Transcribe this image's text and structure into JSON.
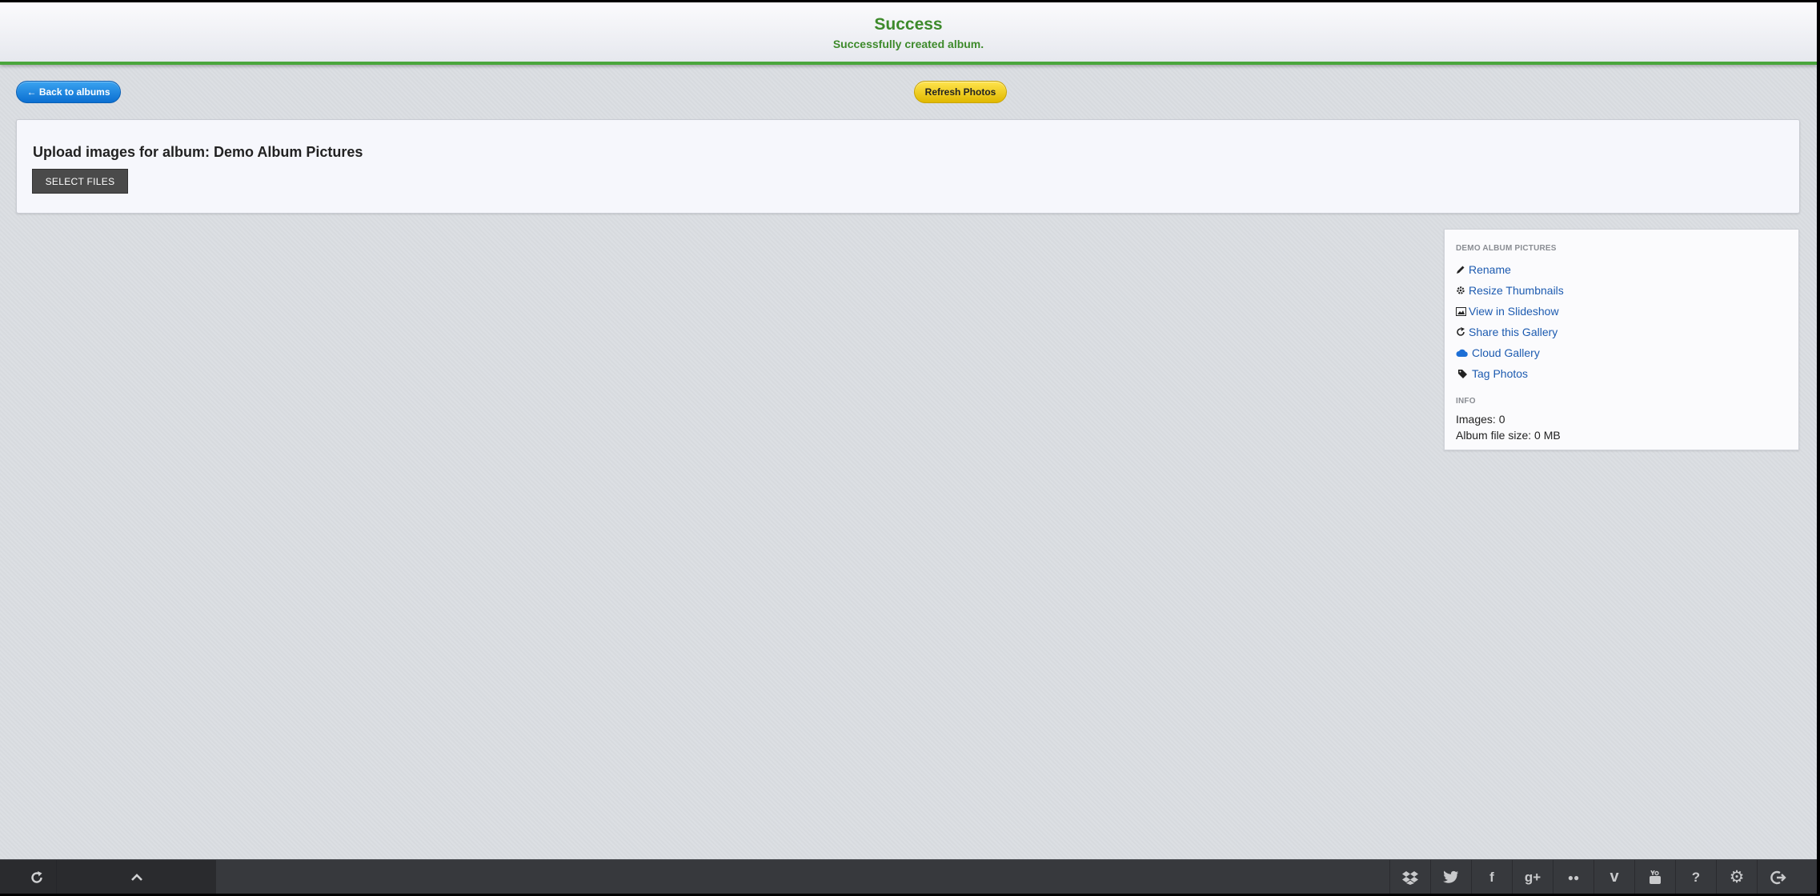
{
  "banner": {
    "title": "Success",
    "message": "Successfully created album.",
    "color": "#3d8a2b"
  },
  "toolbar": {
    "back_label": "← Back to albums",
    "refresh_label": "Refresh Photos"
  },
  "upload": {
    "title": "Upload images for album: Demo Album Pictures",
    "select_label": "SELECT FILES"
  },
  "sidebar": {
    "album_heading": "DEMO ALBUM PICTURES",
    "links": [
      {
        "label": "Rename",
        "icon": "pencil-icon"
      },
      {
        "label": "Resize Thumbnails",
        "icon": "gear-icon"
      },
      {
        "label": "View in Slideshow",
        "icon": "image-icon"
      },
      {
        "label": "Share this Gallery",
        "icon": "share-icon"
      },
      {
        "label": "Cloud Gallery",
        "icon": "cloud-icon"
      },
      {
        "label": "Tag Photos",
        "icon": "tag-icon"
      }
    ],
    "info_heading": "INFO",
    "images_line": "Images: 0",
    "filesize_line": "Album file size: 0 MB"
  },
  "bottom_bar": {
    "left_icons": [
      "refresh-icon",
      "chevron-up-icon"
    ],
    "right_icons": [
      {
        "name": "dropbox-icon",
        "glyph": ""
      },
      {
        "name": "twitter-icon",
        "glyph": ""
      },
      {
        "name": "facebook-icon",
        "glyph": "f"
      },
      {
        "name": "google-plus-icon",
        "glyph": "g+"
      },
      {
        "name": "flickr-icon",
        "glyph": "●●"
      },
      {
        "name": "vimeo-icon",
        "glyph": "v"
      },
      {
        "name": "youtube-icon",
        "glyph": ""
      },
      {
        "name": "help-icon",
        "glyph": "?"
      },
      {
        "name": "settings-gear-icon",
        "glyph": "⚙"
      },
      {
        "name": "logout-icon",
        "glyph": ""
      }
    ]
  },
  "colors": {
    "link": "#1d5bb0",
    "accent_green": "#4aa63c",
    "back_button": "#0b6fd1",
    "refresh_button": "#f0c800"
  }
}
